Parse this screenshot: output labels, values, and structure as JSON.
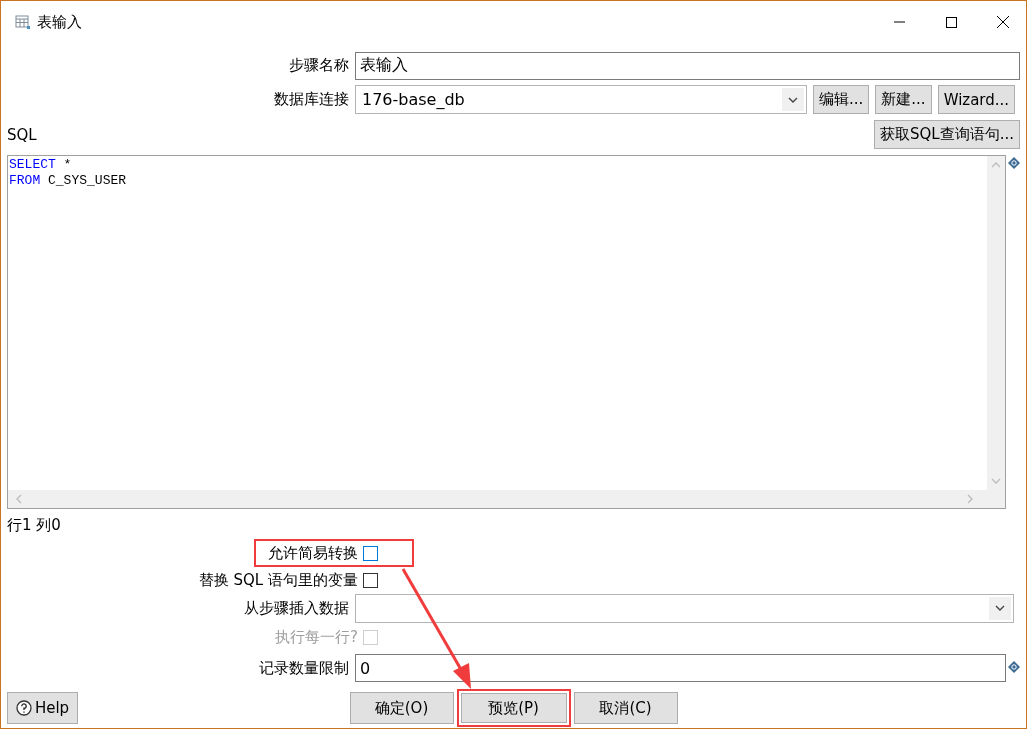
{
  "window": {
    "title": "表输入"
  },
  "step_name": {
    "label": "步骤名称",
    "value": "表输入"
  },
  "connection": {
    "label": "数据库连接",
    "value": "176-base_db",
    "buttons": [
      "编辑...",
      "新建...",
      "Wizard..."
    ]
  },
  "sql": {
    "label": "SQL",
    "get_sql_button": "获取SQL查询语句...",
    "lines": [
      [
        {
          "kind": "keyword",
          "text": "SELECT"
        },
        {
          "kind": "text",
          "text": " *"
        }
      ],
      [
        {
          "kind": "keyword",
          "text": "FROM"
        },
        {
          "kind": "text",
          "text": " C_SYS_USER"
        }
      ]
    ],
    "cursor_position": "行1 列0"
  },
  "options": [
    {
      "kind": "checkbox",
      "label": "允许简易转换",
      "checked": false,
      "disabled": false,
      "highlighted": true
    },
    {
      "kind": "checkbox",
      "label": "替换 SQL 语句里的变量",
      "checked": false,
      "disabled": false,
      "highlighted": false
    },
    {
      "kind": "select",
      "label": "从步骤插入数据"
    },
    {
      "kind": "checkbox",
      "label": "执行每一行?",
      "checked": false,
      "disabled": true,
      "highlighted": false
    },
    {
      "kind": "field",
      "label": "记录数量限制",
      "value": "0"
    }
  ],
  "help_button": "Help",
  "buttons": [
    {
      "label": "确定(O)",
      "highlighted": false
    },
    {
      "label": "预览(P)",
      "highlighted": true
    },
    {
      "label": "取消(C)",
      "highlighted": false
    }
  ]
}
